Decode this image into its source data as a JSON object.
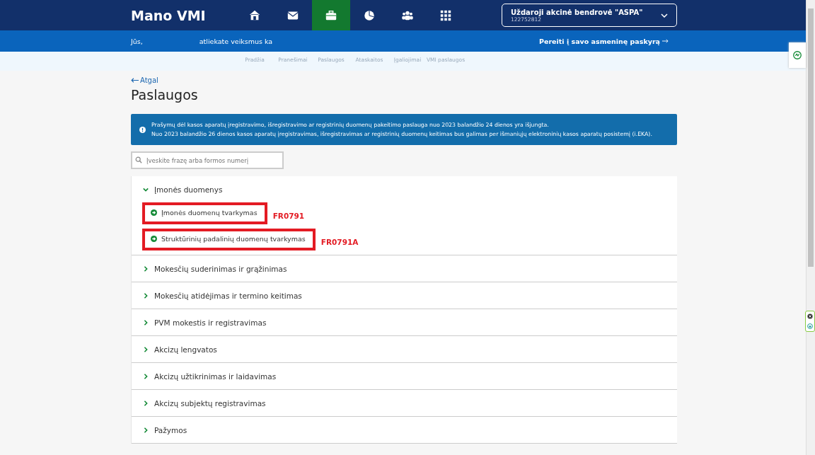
{
  "header": {
    "logo": "Mano VMI",
    "nav": [
      {
        "label": "Pradžia",
        "selected": false
      },
      {
        "label": "Pranešimai",
        "selected": false
      },
      {
        "label": "Paslaugos",
        "selected": true
      },
      {
        "label": "Ataskaitos",
        "selected": false
      },
      {
        "label": "Įgaliojimai",
        "selected": false
      },
      {
        "label": "VMI paslaugos",
        "selected": false
      }
    ],
    "company": {
      "name": "Uždaroji akcinė bendrovė \"ASPA\"",
      "code": "122752812"
    }
  },
  "subbar": {
    "left": "Jūs,",
    "middle": "atliekate veiksmus ka",
    "right": "Pereiti į savo asmeninę paskyrą"
  },
  "back": "Atgal",
  "title": "Paslaugos",
  "notice": [
    "Prašymų dėl kasos aparatų įregistravimo, išregistravimo ar registrinių duomenų pakeitimo paslauga nuo 2023 balandžio 24 dienos yra išjungta.",
    "Nuo 2023 balandžio 26 dienos kasos aparatų įregistravimas, išregistravimas ar registrinių duomenų keitimas bus galimas per išmaniųjų elektroninių kasos aparatų posistemį (i.EKA)."
  ],
  "search": {
    "placeholder": "Įveskite frazę arba formos numerį"
  },
  "sections": [
    {
      "label": "Įmonės duomenys",
      "expanded": true,
      "children": [
        {
          "label": "Įmonės duomenų tvarkymas",
          "annotation": "FR0791"
        },
        {
          "label": "Struktūrinių padalinių duomenų tvarkymas",
          "annotation": "FR0791A"
        }
      ]
    },
    {
      "label": "Mokesčių suderinimas ir grąžinimas",
      "expanded": false
    },
    {
      "label": "Mokesčių atidėjimas ir termino keitimas",
      "expanded": false
    },
    {
      "label": "PVM mokestis ir registravimas",
      "expanded": false
    },
    {
      "label": "Akcizų lengvatos",
      "expanded": false
    },
    {
      "label": "Akcizų užtikrinimas ir laidavimas",
      "expanded": false
    },
    {
      "label": "Akcizų subjektų registravimas",
      "expanded": false
    },
    {
      "label": "Pažymos",
      "expanded": false
    }
  ]
}
